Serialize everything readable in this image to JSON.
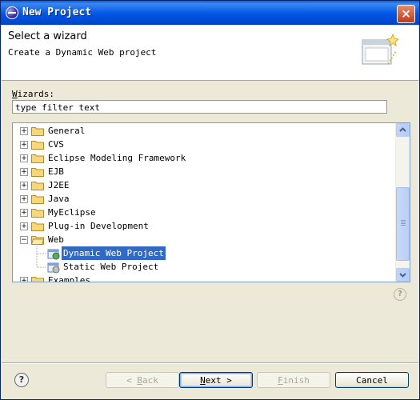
{
  "window": {
    "title": "New Project",
    "close_label": "×"
  },
  "banner": {
    "title": "Select a wizard",
    "description": "Create a Dynamic Web project"
  },
  "wizards": {
    "label_accel": "W",
    "label_rest": "izards:",
    "filter_value": "type filter text"
  },
  "tree": [
    {
      "label": "General",
      "expander": "+"
    },
    {
      "label": "CVS",
      "expander": "+"
    },
    {
      "label": "Eclipse Modeling Framework",
      "expander": "+"
    },
    {
      "label": "EJB",
      "expander": "+"
    },
    {
      "label": "J2EE",
      "expander": "+"
    },
    {
      "label": "Java",
      "expander": "+"
    },
    {
      "label": "MyEclipse",
      "expander": "+"
    },
    {
      "label": "Plug-in Development",
      "expander": "+"
    },
    {
      "label": "Web",
      "expander": "−"
    },
    {
      "label": "Dynamic Web Project"
    },
    {
      "label": "Static Web Project"
    },
    {
      "label": "Examples",
      "expander": "+"
    }
  ],
  "buttons": {
    "help": "?",
    "back_accel": "B",
    "back_rest": "ack",
    "back_prefix": "< ",
    "next_accel": "N",
    "next_rest": "ext",
    "next_suffix": " >",
    "finish_accel": "F",
    "finish_rest": "inish",
    "cancel": "Cancel"
  },
  "colors": {
    "selection": "#316ac5",
    "titlebar": "#0055e5"
  }
}
